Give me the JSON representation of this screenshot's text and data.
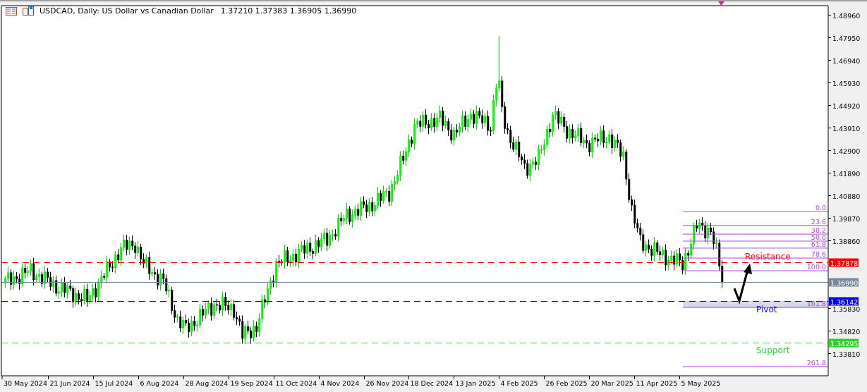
{
  "window": {
    "title": "USDCAD, Daily:  US Dollar vs Canadian Dollar",
    "quotes": "1.37210 1.37383 1.36905 1.36990"
  },
  "chart": {
    "price_ticks": [
      "1.48960",
      "1.47950",
      "1.46940",
      "1.45930",
      "1.44920",
      "1.43910",
      "1.42900",
      "1.41890",
      "1.40880",
      "1.39870",
      "1.38860",
      "1.35830",
      "1.34820",
      "1.33810"
    ],
    "date_ticks": [
      "30 May 2024",
      "21 Jun 2024",
      "15 Jul 2024",
      "6 Aug 2024",
      "28 Aug 2024",
      "19 Sep 2024",
      "11 Oct 2024",
      "4 Nov 2024",
      "26 Nov 2024",
      "18 Dec 2024",
      "13 Jan 2025",
      "4 Feb 2025",
      "26 Feb 2025",
      "20 Mar 2025",
      "11 Apr 2025",
      "5 May 2025"
    ],
    "levels": [
      {
        "kind": "resistance",
        "price_label": "1.37878",
        "label": "Resistance",
        "color": "#ff0000"
      },
      {
        "kind": "current",
        "price_label": "1.36990",
        "color": "#778899"
      },
      {
        "kind": "pivot",
        "price_label": "1.36142",
        "label": "Pivot",
        "color": "#0000ff"
      },
      {
        "kind": "support",
        "price_label": "1.34295",
        "label": "Support",
        "color": "#32cd32"
      }
    ],
    "fib_levels": [
      "0.0",
      "23.6",
      "38.2",
      "50.0",
      "61.8",
      "78.6",
      "100.0",
      "161.8",
      "261.8"
    ]
  }
}
